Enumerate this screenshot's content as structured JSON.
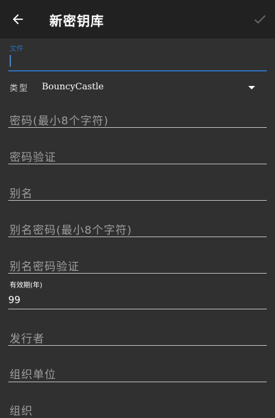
{
  "appbar": {
    "title": "新密钥库",
    "back_icon": "arrow-left-icon",
    "confirm_icon": "check-icon"
  },
  "form": {
    "file_label": "文件",
    "type_label": "类型",
    "type_value": "BouncyCastle",
    "password_placeholder": "密码(最小8个字符)",
    "password_confirm_placeholder": "密码验证",
    "alias_placeholder": "别名",
    "alias_password_placeholder": "别名密码(最小8个字符)",
    "alias_password_confirm_placeholder": "别名密码验证",
    "validity_label": "有效期(年)",
    "validity_value": "99",
    "issuer_placeholder": "发行者",
    "org_unit_placeholder": "组织单位",
    "org_placeholder": "组织"
  },
  "colors": {
    "background": "#303030",
    "appbar": "#212121",
    "accent": "#2f6db3",
    "placeholder": "#9e9e9e",
    "underline": "#bdbdbd"
  }
}
